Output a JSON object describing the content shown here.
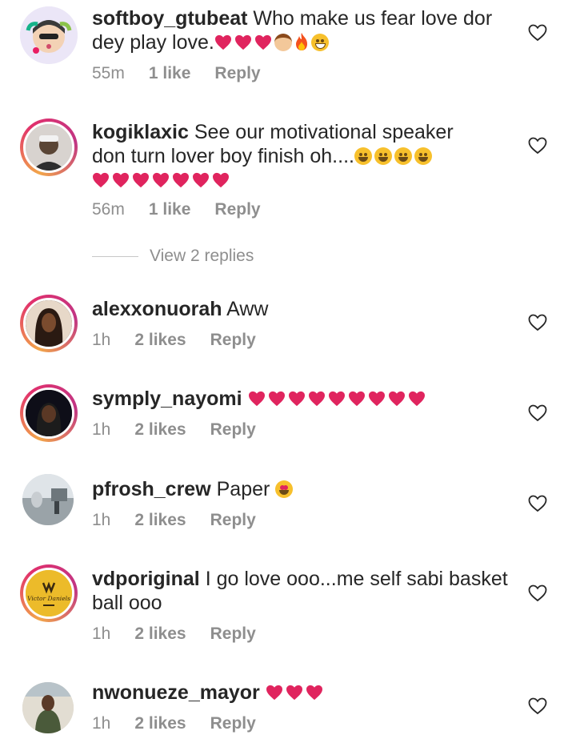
{
  "comments": [
    {
      "username": "softboy_gtubeat",
      "text_line1": "Who make us fear love dor",
      "text_line2": "dey play love.",
      "time": "55m",
      "likes": "1 like",
      "reply": "Reply"
    },
    {
      "username": "kogiklaxic",
      "text_line1": "See our motivational speaker",
      "text_line2": "don turn lover boy finish oh....",
      "time": "56m",
      "likes": "1 like",
      "reply": "Reply"
    },
    {
      "username": "alexxonuorah",
      "text_line1": "Aww",
      "time": "1h",
      "likes": "2 likes",
      "reply": "Reply"
    },
    {
      "username": "symply_nayomi",
      "text_line1": "",
      "time": "1h",
      "likes": "2 likes",
      "reply": "Reply"
    },
    {
      "username": "pfrosh_crew",
      "text_line1": "Paper",
      "time": "1h",
      "likes": "2 likes",
      "reply": "Reply"
    },
    {
      "username": "vdporiginal",
      "text_line1": "I go love ooo...me self sabi basket",
      "text_line2": "ball ooo",
      "time": "1h",
      "likes": "2 likes",
      "reply": "Reply"
    },
    {
      "username": "nwonueze_mayor",
      "text_line1": "",
      "time": "1h",
      "likes": "2 likes",
      "reply": "Reply"
    }
  ],
  "view_replies": "View 2 replies",
  "avatar_logo_text": "Victor Daniels",
  "colors": {
    "emoji_heart": "#e0245e",
    "meta_text": "#8e8e8e",
    "story_ring": "#e1306c"
  }
}
